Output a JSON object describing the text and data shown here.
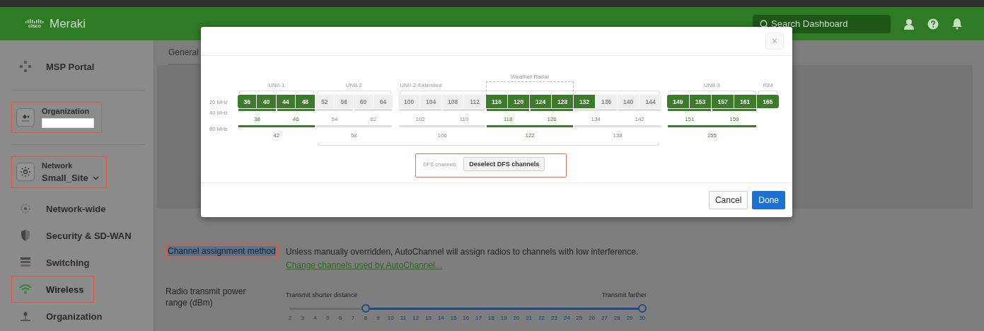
{
  "header": {
    "logo_text": "cisco",
    "product": "Meraki",
    "search": {
      "placeholder": "Search Dashboard"
    }
  },
  "sidebar": {
    "portal": {
      "label": "MSP Portal"
    },
    "context": [
      {
        "kind": "org",
        "title": "Organization",
        "highlighted": true
      },
      {
        "kind": "network",
        "title": "Network",
        "value": "Small_Site",
        "highlighted": true
      }
    ],
    "items": [
      {
        "label": "Network-wide",
        "selected": false,
        "highlighted": false
      },
      {
        "label": "Security & SD-WAN",
        "selected": false,
        "highlighted": false
      },
      {
        "label": "Switching",
        "selected": false,
        "highlighted": false
      },
      {
        "label": "Wireless",
        "selected": true,
        "highlighted": true
      },
      {
        "label": "Organization",
        "selected": false,
        "highlighted": false
      }
    ]
  },
  "content": {
    "tabs": [
      {
        "label": "General",
        "selected": true
      }
    ],
    "channel_assignment": {
      "label": "Channel assignment method",
      "highlighted": true,
      "description": "Unless manually overridden, AutoChannel will assign radios to channels with low interference.",
      "link": "Change channels used by AutoChannel..."
    },
    "power": {
      "label": "Radio transmit power range (dBm)",
      "min_caption": "Transmit shorter distance",
      "max_caption": "Transmit farther",
      "ticks": [
        {
          "label": "2",
          "selected": false
        },
        {
          "label": "3",
          "selected": false
        },
        {
          "label": "4",
          "selected": false
        },
        {
          "label": "5",
          "selected": false
        },
        {
          "label": "6",
          "selected": false
        },
        {
          "label": "7",
          "selected": false
        },
        {
          "label": "8",
          "selected": true
        },
        {
          "label": "9",
          "selected": true
        },
        {
          "label": "10",
          "selected": true
        },
        {
          "label": "11",
          "selected": true
        },
        {
          "label": "12",
          "selected": true
        },
        {
          "label": "13",
          "selected": true
        },
        {
          "label": "14",
          "selected": true
        },
        {
          "label": "15",
          "selected": true
        },
        {
          "label": "16",
          "selected": true
        },
        {
          "label": "17",
          "selected": true
        },
        {
          "label": "18",
          "selected": true
        },
        {
          "label": "19",
          "selected": true
        },
        {
          "label": "20",
          "selected": true
        },
        {
          "label": "21",
          "selected": true
        },
        {
          "label": "22",
          "selected": true
        },
        {
          "label": "23",
          "selected": true
        },
        {
          "label": "24",
          "selected": true
        },
        {
          "label": "25",
          "selected": true
        },
        {
          "label": "26",
          "selected": true
        },
        {
          "label": "27",
          "selected": true
        },
        {
          "label": "28",
          "selected": true
        },
        {
          "label": "29",
          "selected": true
        },
        {
          "label": "30",
          "selected": true
        }
      ]
    }
  },
  "modal": {
    "close": "×",
    "row_labels": [
      "20 MHz",
      "40 MHz",
      "80 MHz"
    ],
    "bands": [
      {
        "kind": "band",
        "label": "UNII-1"
      },
      {
        "kind": "band",
        "label": "UNII-2"
      },
      {
        "kind": "wide",
        "label": "UNII-2-Extended"
      },
      {
        "kind": "radar",
        "label": "Weather Radar"
      },
      {
        "kind": "band",
        "label": "UNII-3"
      },
      {
        "kind": "band",
        "label": "ISM"
      }
    ],
    "channel_groups": [
      {
        "channels": [
          {
            "label": "36",
            "selected": true
          },
          {
            "label": "40",
            "selected": true
          },
          {
            "label": "44",
            "selected": true
          },
          {
            "label": "48",
            "selected": true
          },
          {
            "label": "52",
            "selected": false
          },
          {
            "label": "56",
            "selected": false
          },
          {
            "label": "60",
            "selected": false
          },
          {
            "label": "64",
            "selected": false
          }
        ],
        "wide40": [
          {
            "label": "38",
            "selected": true
          },
          {
            "label": "46",
            "selected": true
          },
          {
            "label": "54",
            "selected": false
          },
          {
            "label": "62",
            "selected": false
          }
        ],
        "wide80": [
          {
            "label": "42",
            "selected": true
          },
          {
            "label": "58",
            "selected": false
          }
        ]
      },
      {
        "channels": [
          {
            "label": "100",
            "selected": false
          },
          {
            "label": "104",
            "selected": false
          },
          {
            "label": "108",
            "selected": false
          },
          {
            "label": "112",
            "selected": false
          },
          {
            "label": "116",
            "selected": true
          },
          {
            "label": "120",
            "selected": true
          },
          {
            "label": "124",
            "selected": true
          },
          {
            "label": "128",
            "selected": true
          },
          {
            "label": "132",
            "selected": true
          },
          {
            "label": "136",
            "selected": false
          },
          {
            "label": "140",
            "selected": false
          },
          {
            "label": "144",
            "selected": false
          }
        ],
        "wide40": [
          {
            "label": "102",
            "selected": false
          },
          {
            "label": "110",
            "selected": false
          },
          {
            "label": "118",
            "selected": true
          },
          {
            "label": "126",
            "selected": true
          },
          {
            "label": "134",
            "selected": false
          },
          {
            "label": "142",
            "selected": false
          }
        ],
        "wide80": [
          {
            "label": "106",
            "selected": false
          },
          {
            "label": "122",
            "selected": true
          },
          {
            "label": "138",
            "selected": false
          }
        ]
      },
      {
        "channels": [
          {
            "label": "149",
            "selected": true
          },
          {
            "label": "153",
            "selected": true
          },
          {
            "label": "157",
            "selected": true
          },
          {
            "label": "161",
            "selected": true
          },
          {
            "label": "165",
            "selected": true
          }
        ],
        "wide40": [
          {
            "label": "151",
            "selected": true
          },
          {
            "label": "159",
            "selected": true
          }
        ],
        "wide80": [
          {
            "label": "155",
            "selected": true
          }
        ]
      }
    ],
    "dfs": {
      "label": "DFS channels",
      "button": "Deselect DFS channels",
      "highlighted": true
    },
    "buttons": [
      {
        "kind": "secondary",
        "label": "Cancel"
      },
      {
        "kind": "primary",
        "label": "Done"
      }
    ]
  }
}
